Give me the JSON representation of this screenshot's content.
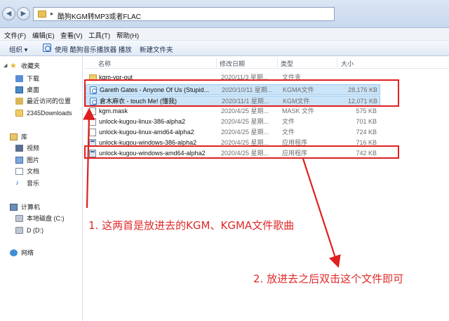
{
  "window": {
    "address_path": "酷狗KGM转MP3或者FLAC",
    "nav_back_glyph": "◀",
    "nav_forward_glyph": "▶",
    "address_arrow": "▸"
  },
  "menubar": [
    {
      "label": "文件(F)"
    },
    {
      "label": "编辑(E)"
    },
    {
      "label": "查看(V)"
    },
    {
      "label": "工具(T)"
    },
    {
      "label": "帮助(H)"
    }
  ],
  "toolbar": {
    "organize": "组织 ▾",
    "play_with": "使用 酷狗音乐播放器 播放",
    "new_folder": "新建文件夹"
  },
  "columns": {
    "name": "名称",
    "date": "修改日期",
    "type": "类型",
    "size": "大小"
  },
  "sidebar": {
    "favorites": "收藏夹",
    "downloads": "下载",
    "desktop": "桌面",
    "recent": "最近访问的位置",
    "folder_2345": "2345Downloads",
    "library": "库",
    "video": "视频",
    "pictures": "图片",
    "documents": "文档",
    "music": "音乐",
    "computer": "计算机",
    "local_disk_c": "本地磁盘 (C:)",
    "drive_d": "D (D:)",
    "network": "网络"
  },
  "files": [
    {
      "icon": "folder-icon",
      "name": "kgm-vpr-out",
      "date": "2020/11/3 星期...",
      "type": "文件夹",
      "size": ""
    },
    {
      "icon": "kgma-file-icon",
      "name": "Gareth Gates - Anyone Of Us (Stupid...",
      "date": "2020/10/11 星期...",
      "type": "KGMA文件",
      "size": "28,176 KB",
      "selected": true
    },
    {
      "icon": "kgm-file-icon",
      "name": "倉木麻衣 - touch Me! (懂我)",
      "date": "2020/11/1 星期...",
      "type": "KGM文件",
      "size": "12,071 KB",
      "selected": true
    },
    {
      "icon": "file-icon",
      "name": "kgm.mask",
      "date": "2020/4/25 星期...",
      "type": "MASK 文件",
      "size": "575 KB"
    },
    {
      "icon": "file-icon",
      "name": "unlock-kugou-linux-386-alpha2",
      "date": "2020/4/25 星期...",
      "type": "文件",
      "size": "701 KB"
    },
    {
      "icon": "file-icon",
      "name": "unlock-kugou-linux-amd64-alpha2",
      "date": "2020/4/25 星期...",
      "type": "文件",
      "size": "724 KB"
    },
    {
      "icon": "exe-icon",
      "name": "unlock-kugou-windows-386-alpha2",
      "date": "2020/4/25 星期...",
      "type": "应用程序",
      "size": "716 KB"
    },
    {
      "icon": "exe-icon",
      "name": "unlock-kugou-windows-amd64-alpha2",
      "date": "2020/4/25 星期...",
      "type": "应用程序",
      "size": "742 KB"
    }
  ],
  "annotations": {
    "note1": "1. 这两首是放进去的KGM、KGMA文件歌曲",
    "note2": "2. 放进去之后双击这个文件即可",
    "color": "#e02020"
  }
}
